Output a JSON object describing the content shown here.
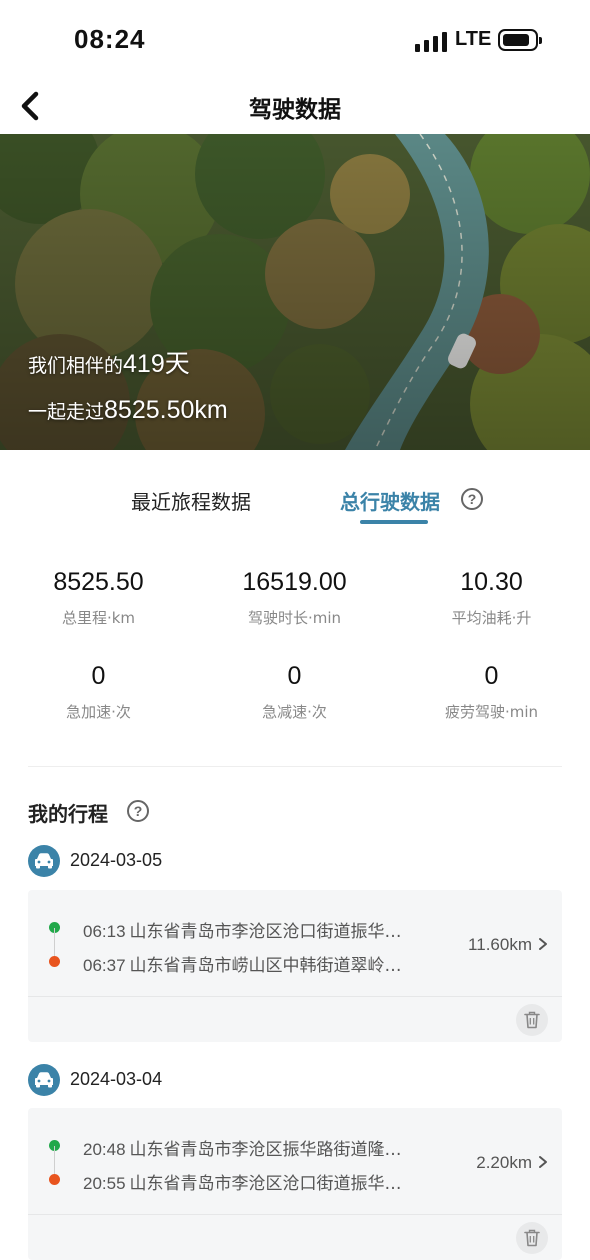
{
  "status_bar": {
    "time": "08:24",
    "network": "LTE",
    "signal_icon": "signal-icon",
    "battery_icon": "battery-icon"
  },
  "nav": {
    "title": "驾驶数据",
    "back_icon": "chevron-left-icon"
  },
  "hero": {
    "line1_prefix": "我们相伴的",
    "days": "419天",
    "line2_prefix": "一起走过",
    "distance": "8525.50km"
  },
  "tabs": [
    {
      "label": "最近旅程数据",
      "active": false
    },
    {
      "label": "总行驶数据",
      "active": true
    }
  ],
  "accent_color": "#3b83a8",
  "stats": [
    {
      "value": "8525.50",
      "label": "总里程·km"
    },
    {
      "value": "16519.00",
      "label": "驾驶时长·min"
    },
    {
      "value": "10.30",
      "label": "平均油耗·升"
    },
    {
      "value": "0",
      "label": "急加速·次"
    },
    {
      "value": "0",
      "label": "急减速·次"
    },
    {
      "value": "0",
      "label": "疲劳驾驶·min"
    }
  ],
  "my_trips": {
    "title": "我的行程",
    "groups": [
      {
        "date": "2024-03-05",
        "trips": [
          {
            "start_time": "06:13",
            "start_address": "山东省青岛市李沧区沧口街道振华…",
            "end_time": "06:37",
            "end_address": "山东省青岛市崂山区中韩街道翠岭…",
            "distance": "11.60km"
          }
        ]
      },
      {
        "date": "2024-03-04",
        "trips": [
          {
            "start_time": "20:48",
            "start_address": "山东省青岛市李沧区振华路街道隆…",
            "end_time": "20:55",
            "end_address": "山东省青岛市李沧区沧口街道振华…",
            "distance": "2.20km"
          }
        ]
      }
    ]
  }
}
